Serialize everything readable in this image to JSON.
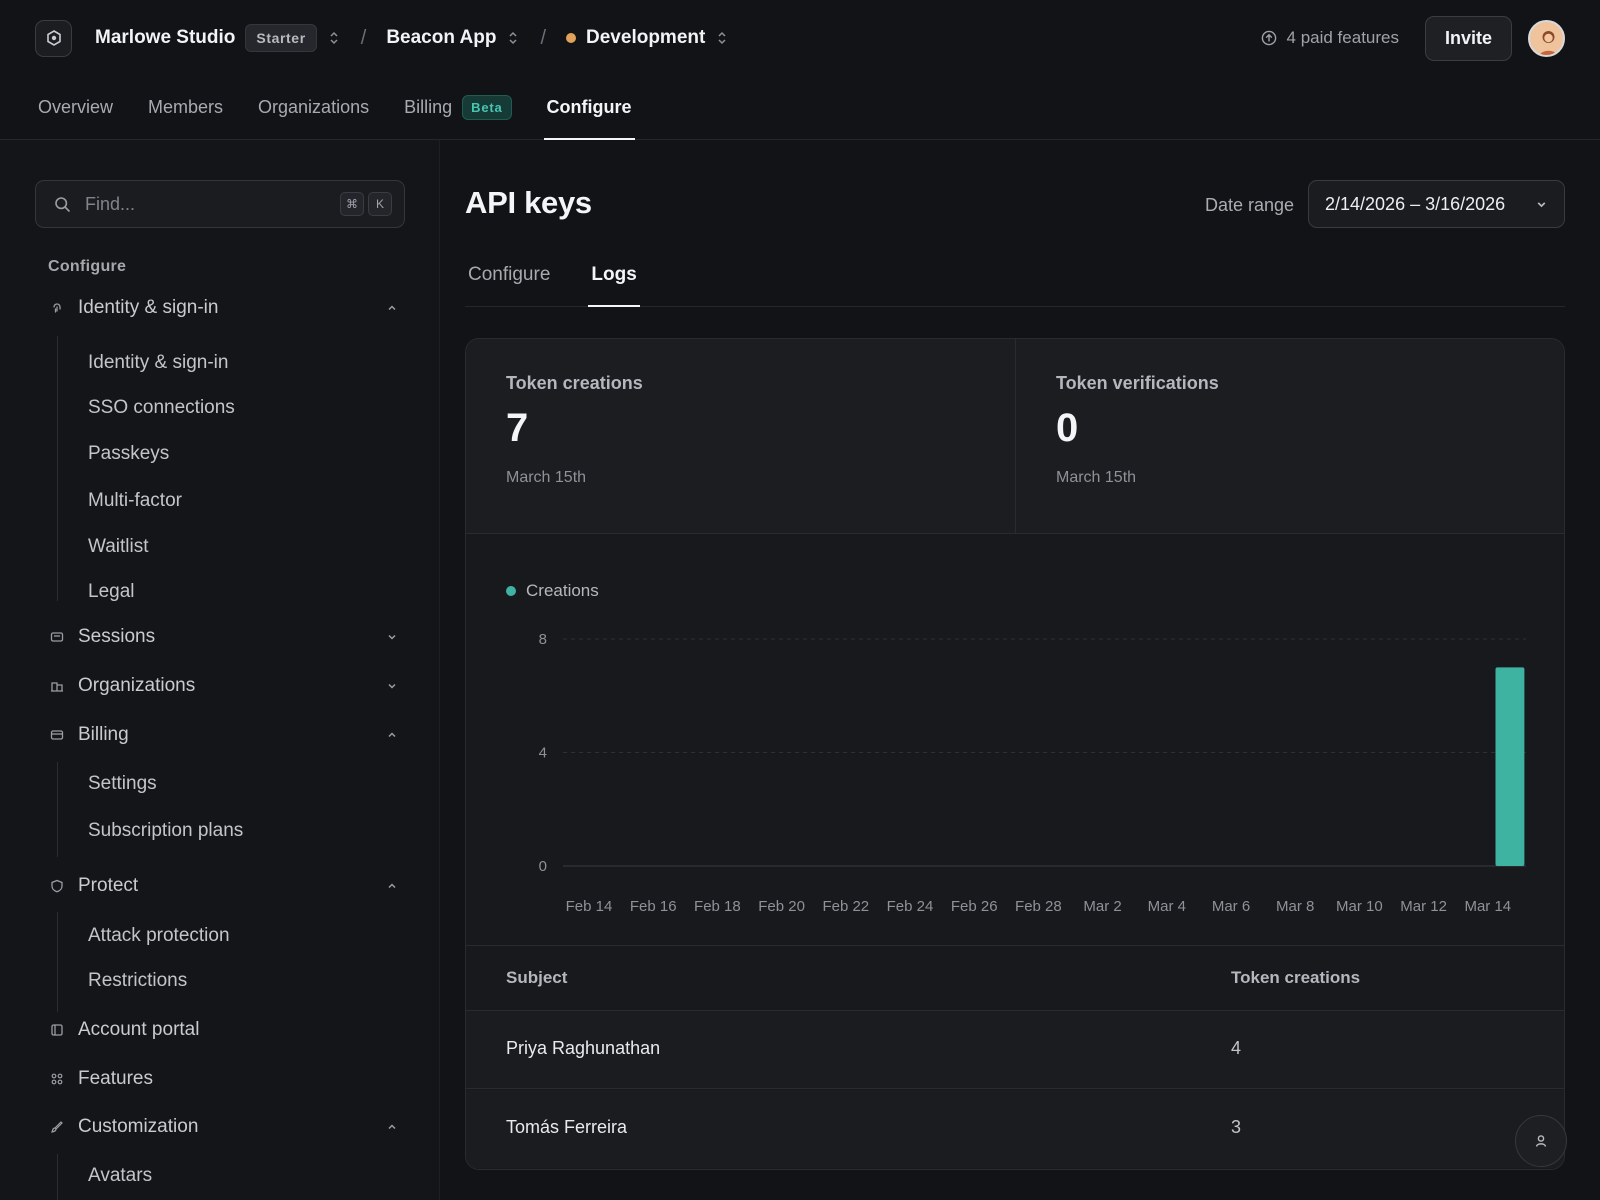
{
  "topbar": {
    "org_name": "Marlowe Studio",
    "plan": "Starter",
    "app_name": "Beacon App",
    "env_name": "Development",
    "env_color": "#e2a15b",
    "paid_features": "4 paid features",
    "invite_label": "Invite"
  },
  "main_tabs": [
    {
      "label": "Overview"
    },
    {
      "label": "Members"
    },
    {
      "label": "Organizations"
    },
    {
      "label": "Billing",
      "badge": "Beta"
    },
    {
      "label": "Configure",
      "active": true
    }
  ],
  "sidebar": {
    "search_placeholder": "Find...",
    "shortcut": [
      "⌘",
      "K"
    ],
    "heading": "Configure",
    "groups": [
      {
        "label": "Identity & sign-in",
        "icon": "fingerprint-icon",
        "expanded": true,
        "items": [
          "Identity & sign-in",
          "SSO connections",
          "Passkeys",
          "Multi-factor",
          "Waitlist",
          "Legal"
        ]
      },
      {
        "label": "Sessions",
        "icon": "session-icon",
        "expanded": false,
        "items": []
      },
      {
        "label": "Organizations",
        "icon": "building-icon",
        "expanded": false,
        "items": []
      },
      {
        "label": "Billing",
        "icon": "credit-card-icon",
        "expanded": true,
        "items": [
          "Settings",
          "Subscription plans"
        ]
      },
      {
        "label": "Protect",
        "icon": "shield-icon",
        "expanded": true,
        "items": [
          "Attack protection",
          "Restrictions"
        ]
      },
      {
        "label": "Account portal",
        "icon": "portal-icon",
        "items": []
      },
      {
        "label": "Features",
        "icon": "grid-icon",
        "items": []
      },
      {
        "label": "Customization",
        "icon": "brush-icon",
        "expanded": true,
        "items": [
          "Avatars"
        ]
      }
    ]
  },
  "page": {
    "title": "API keys",
    "date_range_label": "Date range",
    "date_range_value": "2/14/2026 – 3/16/2026",
    "tabs": [
      {
        "label": "Configure"
      },
      {
        "label": "Logs",
        "active": true
      }
    ]
  },
  "stats": [
    {
      "label": "Token creations",
      "value": "7",
      "date": "March 15th"
    },
    {
      "label": "Token verifications",
      "value": "0",
      "date": "March 15th"
    }
  ],
  "chart_data": {
    "type": "bar",
    "legend": "Creations",
    "color": "#3fb3a2",
    "categories": [
      "Feb 14",
      "Feb 15",
      "Feb 16",
      "Feb 17",
      "Feb 18",
      "Feb 19",
      "Feb 20",
      "Feb 21",
      "Feb 22",
      "Feb 23",
      "Feb 24",
      "Feb 25",
      "Feb 26",
      "Feb 27",
      "Feb 28",
      "Mar 1",
      "Mar 2",
      "Mar 3",
      "Mar 4",
      "Mar 5",
      "Mar 6",
      "Mar 7",
      "Mar 8",
      "Mar 9",
      "Mar 10",
      "Mar 11",
      "Mar 12",
      "Mar 13",
      "Mar 14",
      "Mar 15"
    ],
    "tick_labels": [
      "Feb 14",
      "Feb 16",
      "Feb 18",
      "Feb 20",
      "Feb 22",
      "Feb 24",
      "Feb 26",
      "Feb 28",
      "Mar 2",
      "Mar 4",
      "Mar 6",
      "Mar 8",
      "Mar 10",
      "Mar 12",
      "Mar 14"
    ],
    "series": [
      {
        "name": "Creations",
        "values": [
          0,
          0,
          0,
          0,
          0,
          0,
          0,
          0,
          0,
          0,
          0,
          0,
          0,
          0,
          0,
          0,
          0,
          0,
          0,
          0,
          0,
          0,
          0,
          0,
          0,
          0,
          0,
          0,
          0,
          7
        ]
      }
    ],
    "ylim": [
      0,
      8
    ],
    "yticks": [
      0,
      4,
      8
    ],
    "grid": true
  },
  "table": {
    "columns": [
      "Subject",
      "Token creations"
    ],
    "rows": [
      {
        "subject": "Priya Raghunathan",
        "count": "4"
      },
      {
        "subject": "Tomás Ferreira",
        "count": "3"
      }
    ]
  }
}
